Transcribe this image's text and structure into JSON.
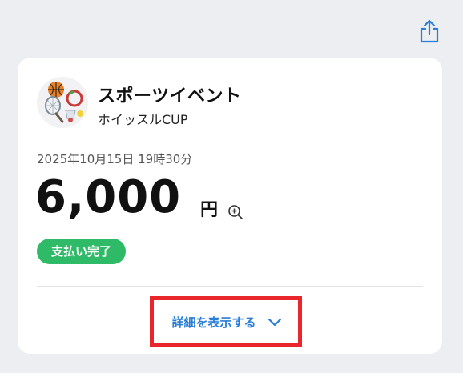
{
  "header": {
    "share_icon": "share-icon"
  },
  "merchant": {
    "name": "スポーツイベント",
    "subtitle": "ホイッスルCUP",
    "avatar_icon": "sports-balls-icon"
  },
  "payment": {
    "datetime": "2025年10月15日 19時30分",
    "amount": "6,000",
    "currency": "円",
    "zoom_icon": "zoom-in-icon",
    "status": "支払い完了",
    "status_color": "#2fba67"
  },
  "details": {
    "toggle_label": "詳細を表示する",
    "chevron_icon": "chevron-down-icon",
    "link_color": "#2a7ed8"
  },
  "annotation": {
    "highlight_color": "#e8262c"
  }
}
